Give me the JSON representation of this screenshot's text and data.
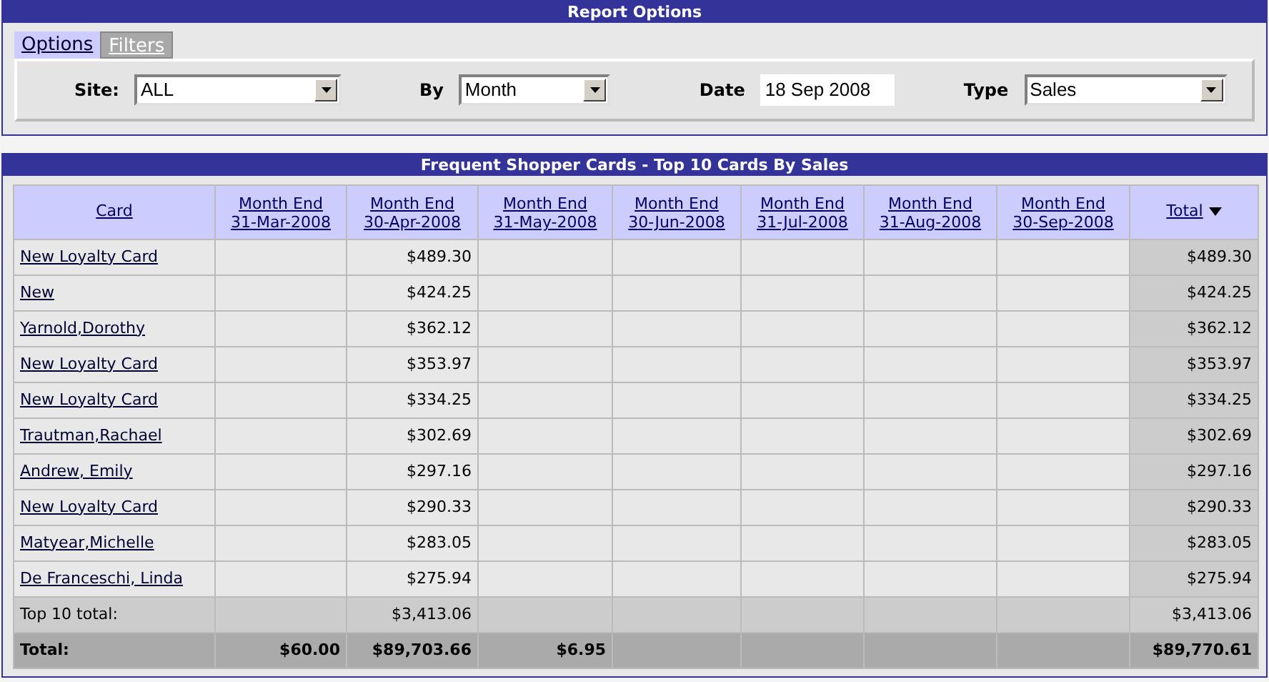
{
  "options_panel": {
    "title": "Report Options",
    "tabs": [
      {
        "label": "Options",
        "selected": true
      },
      {
        "label": "Filters",
        "selected": false
      }
    ],
    "fields": [
      {
        "label": "Site:",
        "kind": "select",
        "value": "ALL"
      },
      {
        "label": "By",
        "kind": "select",
        "value": "Month"
      },
      {
        "label": "Date",
        "kind": "text",
        "value": "18 Sep 2008"
      },
      {
        "label": "Type",
        "kind": "select",
        "value": "Sales"
      }
    ]
  },
  "report": {
    "title": "Frequent Shopper Cards - Top 10 Cards By Sales",
    "columns": [
      {
        "lines": [
          "Card"
        ],
        "sorted": false
      },
      {
        "lines": [
          "Month End",
          "31-Mar-2008"
        ],
        "sorted": false
      },
      {
        "lines": [
          "Month End",
          "30-Apr-2008"
        ],
        "sorted": false
      },
      {
        "lines": [
          "Month End",
          "31-May-2008"
        ],
        "sorted": false
      },
      {
        "lines": [
          "Month End",
          "30-Jun-2008"
        ],
        "sorted": false
      },
      {
        "lines": [
          "Month End",
          "31-Jul-2008"
        ],
        "sorted": false
      },
      {
        "lines": [
          "Month End",
          "31-Aug-2008"
        ],
        "sorted": false
      },
      {
        "lines": [
          "Month End",
          "30-Sep-2008"
        ],
        "sorted": false
      },
      {
        "lines": [
          "Total"
        ],
        "sorted": true
      }
    ],
    "rows": [
      {
        "card": "New Loyalty Card",
        "month_2": "$489.30",
        "total": "$489.30"
      },
      {
        "card": "New",
        "month_2": "$424.25",
        "total": "$424.25"
      },
      {
        "card": "Yarnold,Dorothy",
        "month_2": "$362.12",
        "total": "$362.12"
      },
      {
        "card": "New Loyalty Card",
        "month_2": "$353.97",
        "total": "$353.97"
      },
      {
        "card": "New Loyalty Card",
        "month_2": "$334.25",
        "total": "$334.25"
      },
      {
        "card": "Trautman,Rachael",
        "month_2": "$302.69",
        "total": "$302.69"
      },
      {
        "card": "Andrew, Emily",
        "month_2": "$297.16",
        "total": "$297.16"
      },
      {
        "card": "New Loyalty Card",
        "month_2": "$290.33",
        "total": "$290.33"
      },
      {
        "card": "Matyear,Michelle",
        "month_2": "$283.05",
        "total": "$283.05"
      },
      {
        "card": "De Franceschi, Linda",
        "month_2": "$275.94",
        "total": "$275.94"
      }
    ],
    "summary": [
      {
        "kind": "subtotal",
        "label": "Top 10 total:",
        "month_2": "$3,413.06",
        "total": "$3,413.06"
      },
      {
        "kind": "grand",
        "label": "Total:",
        "month_1": "$60.00",
        "month_2": "$89,703.66",
        "month_3": "$6.95",
        "total": "$89,770.61"
      }
    ]
  }
}
